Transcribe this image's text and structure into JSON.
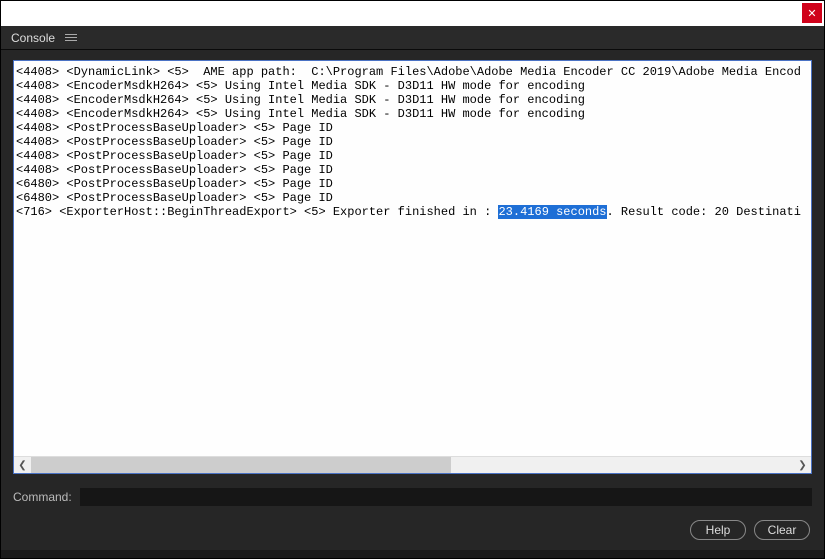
{
  "panel": {
    "title": "Console"
  },
  "log": {
    "lines": [
      {
        "text": "<4408> <DynamicLink> <5>  AME app path:  C:\\Program Files\\Adobe\\Adobe Media Encoder CC 2019\\Adobe Media Encod"
      },
      {
        "text": "<4408> <EncoderMsdkH264> <5> Using Intel Media SDK - D3D11 HW mode for encoding"
      },
      {
        "text": "<4408> <EncoderMsdkH264> <5> Using Intel Media SDK - D3D11 HW mode for encoding"
      },
      {
        "text": "<4408> <EncoderMsdkH264> <5> Using Intel Media SDK - D3D11 HW mode for encoding"
      },
      {
        "text": "<4408> <PostProcessBaseUploader> <5> Page ID"
      },
      {
        "text": "<4408> <PostProcessBaseUploader> <5> Page ID"
      },
      {
        "text": "<4408> <PostProcessBaseUploader> <5> Page ID"
      },
      {
        "text": "<4408> <PostProcessBaseUploader> <5> Page ID"
      },
      {
        "text": "<6480> <PostProcessBaseUploader> <5> Page ID"
      },
      {
        "text": "<6480> <PostProcessBaseUploader> <5> Page ID"
      },
      {
        "prefix": "<716> <ExporterHost::BeginThreadExport> <5> Exporter finished in : ",
        "highlight": "23.4169 seconds",
        "suffix": ". Result code: 20 Destinati"
      }
    ]
  },
  "command": {
    "label": "Command:",
    "value": ""
  },
  "buttons": {
    "help": "Help",
    "clear": "Clear"
  },
  "close_glyph": "✕",
  "scroll": {
    "left_glyph": "❮",
    "right_glyph": "❯"
  }
}
